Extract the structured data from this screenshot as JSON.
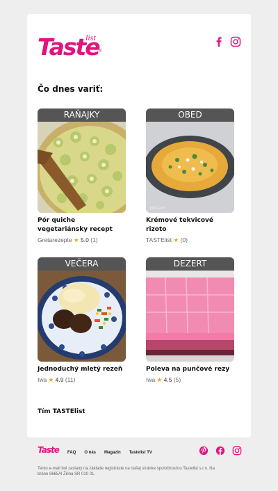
{
  "brand": {
    "logo_main": "Taste",
    "logo_sub": "list",
    "logo_reg": "®",
    "accent_color": "#e2147e"
  },
  "header_icons": [
    "facebook-icon",
    "instagram-icon"
  ],
  "heading": "Čo dnes variť:",
  "recipes": [
    {
      "category": "Raňajky",
      "title": "Pór quiche vegetariánsky recept",
      "author": "Gretarezepte",
      "rating": "5.0",
      "count": "(1)"
    },
    {
      "category": "Obed",
      "title": "Krémové tekvicové rizoto",
      "author": "TASTElist",
      "rating": "",
      "count": "(0)"
    },
    {
      "category": "Večera",
      "title": "Jednoduchý mletý rezeň",
      "author": "Iwa",
      "rating": "4.9",
      "count": "(11)"
    },
    {
      "category": "Dezert",
      "title": "Poleva na punčové rezy",
      "author": "Iwa",
      "rating": "4.5",
      "count": "(5)"
    }
  ],
  "signoff": "Tím TASTElist",
  "footer": {
    "logo": "Taste",
    "links": [
      "FAQ",
      "O nás",
      "Magazín",
      "Tastelist TV"
    ],
    "icons": [
      "pinterest-icon",
      "facebook-icon",
      "instagram-icon"
    ],
    "disclaimer": "Tento e-mail bol zaslaný na základe registrácie na našej stránke spoločnosťou Tastelist s.r.o. Na bráne 8665/4 Žilina SR 010 01."
  }
}
